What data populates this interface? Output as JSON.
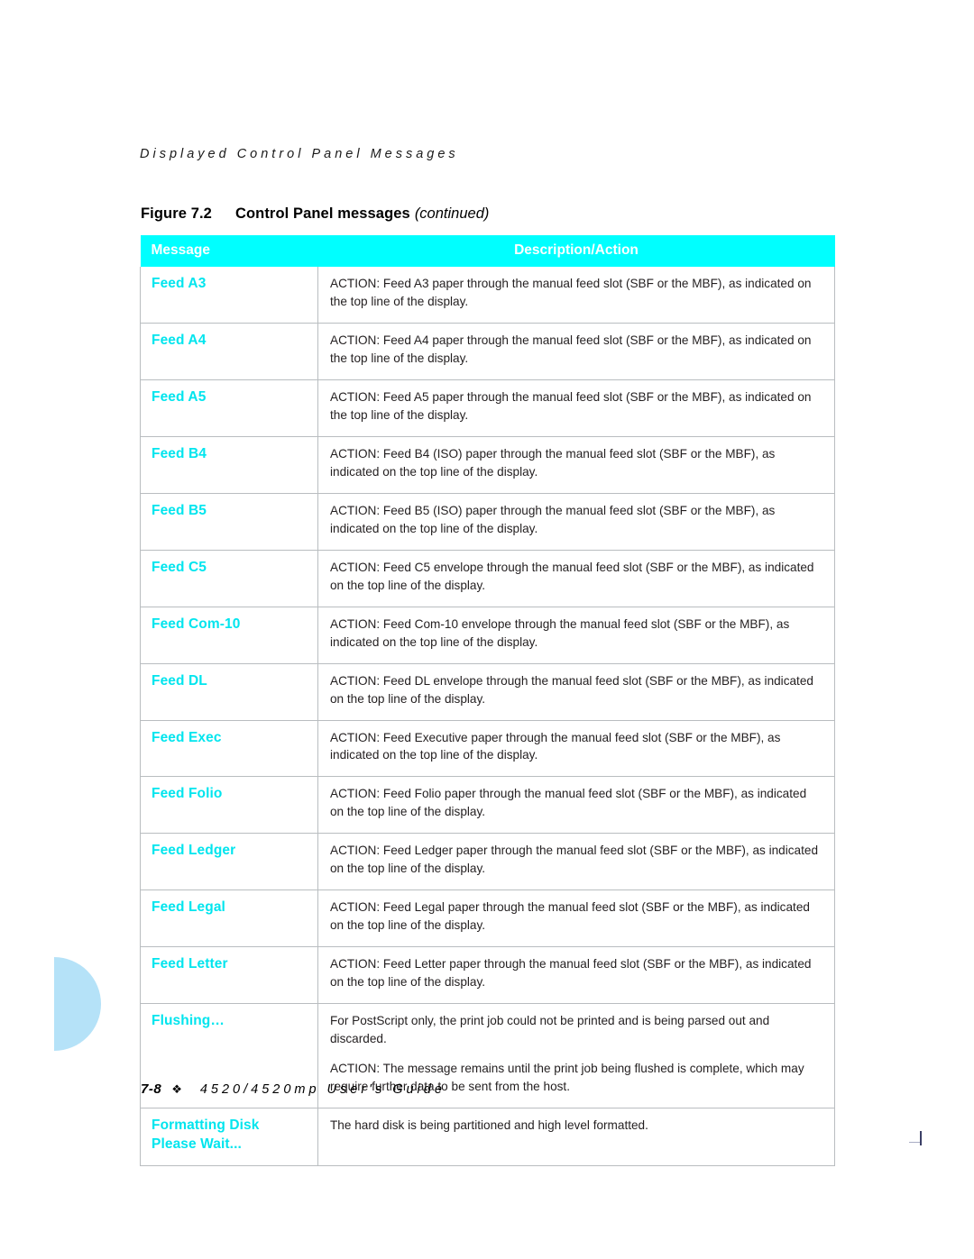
{
  "page": {
    "running_head": "Displayed Control Panel Messages",
    "footer": {
      "page_number": "7-8",
      "diamond": "❖",
      "guide_title": "4520/4520mp User's Guide"
    }
  },
  "figure": {
    "number": "Figure 7.2",
    "title": "Control Panel messages",
    "continued": "(continued)"
  },
  "colors": {
    "header_fill": "#00FFFF",
    "header_text": "#FFFFFF",
    "message_text": "#00E5EE",
    "body_text": "#231F20",
    "rule": "#B9BDC0",
    "decoration": "#B5E2F8"
  },
  "table": {
    "columns": [
      "Message",
      "Description/Action"
    ],
    "rows": [
      {
        "message": [
          "Feed A3"
        ],
        "description": [
          "ACTION: Feed A3 paper through the manual feed slot (SBF or the MBF), as indicated on the top line of the display."
        ]
      },
      {
        "message": [
          "Feed A4"
        ],
        "description": [
          "ACTION: Feed A4 paper through the manual feed slot (SBF or the MBF), as indicated on the top line of the display."
        ]
      },
      {
        "message": [
          "Feed A5"
        ],
        "description": [
          "ACTION: Feed A5 paper through the manual feed slot (SBF or the MBF), as indicated on the top line of the display."
        ]
      },
      {
        "message": [
          "Feed B4"
        ],
        "description": [
          "ACTION: Feed B4 (ISO) paper through the manual feed slot (SBF or the MBF), as indicated on the top line of the display."
        ]
      },
      {
        "message": [
          "Feed B5"
        ],
        "description": [
          "ACTION: Feed B5 (ISO) paper through the manual feed slot (SBF or the MBF), as indicated on the top line of the display."
        ]
      },
      {
        "message": [
          "Feed C5"
        ],
        "description": [
          "ACTION: Feed C5 envelope through the manual feed slot (SBF or the MBF), as indicated on the top line of the display."
        ]
      },
      {
        "message": [
          "Feed Com-10"
        ],
        "description": [
          "ACTION: Feed Com-10 envelope through the manual feed slot (SBF or the MBF), as indicated on the top line of the display."
        ]
      },
      {
        "message": [
          "Feed DL"
        ],
        "description": [
          "ACTION: Feed DL envelope through the manual feed slot (SBF or the MBF), as indicated on the top line of the display."
        ]
      },
      {
        "message": [
          "Feed Exec"
        ],
        "description": [
          "ACTION: Feed Executive paper through the manual feed slot (SBF or the MBF), as indicated on the top line of the display."
        ]
      },
      {
        "message": [
          "Feed Folio"
        ],
        "description": [
          "ACTION: Feed Folio paper through the manual feed slot (SBF or the MBF), as indicated on the top line of the display."
        ]
      },
      {
        "message": [
          "Feed Ledger"
        ],
        "description": [
          "ACTION: Feed Ledger paper through the manual feed slot (SBF or the MBF), as indicated on the top line of the display."
        ]
      },
      {
        "message": [
          "Feed Legal"
        ],
        "description": [
          "ACTION: Feed Legal paper through the manual feed slot (SBF or the MBF), as indicated on the top line of the display."
        ]
      },
      {
        "message": [
          "Feed Letter"
        ],
        "description": [
          "ACTION: Feed Letter paper through the manual feed slot (SBF or the MBF), as indicated on the top line of the display."
        ]
      },
      {
        "message": [
          "Flushing…"
        ],
        "description": [
          "For PostScript only, the print job could not be printed and is being parsed out and discarded.",
          "ACTION: The message remains until the print job being flushed is complete, which may require further data to be sent from the host."
        ]
      },
      {
        "message": [
          "Formatting Disk",
          "Please Wait..."
        ],
        "description": [
          "The hard disk is being partitioned and high level formatted."
        ]
      }
    ]
  }
}
